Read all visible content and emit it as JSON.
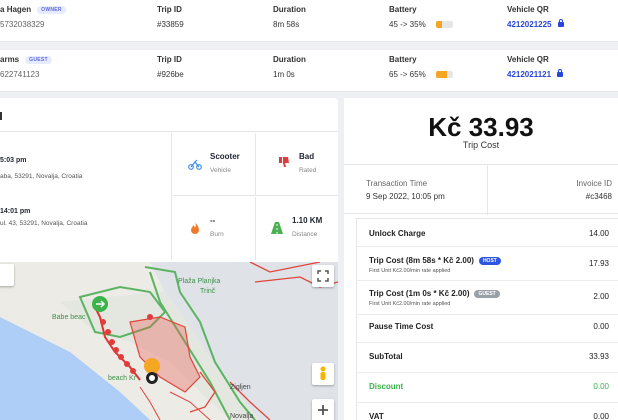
{
  "trips": [
    {
      "user_name": "Hagen",
      "user_name_prefix": "a",
      "role": "OWNER",
      "phone": "5732038329",
      "trip_id_label": "Trip ID",
      "trip_id": "#33859",
      "duration_label": "Duration",
      "duration": "8m 58s",
      "battery_label": "Battery",
      "battery": "45 -> 35%",
      "battery_level": 0.35,
      "vehicle_qr_label": "Vehicle QR",
      "vehicle_qr": "4212021225"
    },
    {
      "user_name": "arms",
      "role": "GUEST",
      "phone": "622741123",
      "trip_id_label": "Trip ID",
      "trip_id": "#926be",
      "duration_label": "Duration",
      "duration": "1m 0s",
      "battery_label": "Battery",
      "battery": "65 -> 65%",
      "battery_level": 0.65,
      "vehicle_qr_label": "Vehicle QR",
      "vehicle_qr": "4212021121"
    }
  ],
  "detail": {
    "route": {
      "start_time": "5:03 pm",
      "start_address": "aba, 53291, Novalja, Croatia",
      "end_time": "14:01 pm",
      "end_address": "ul. 43, 53291, Novalja, Croatia"
    },
    "stats": [
      {
        "value": "Scooter",
        "label": "Vehicle",
        "icon": "scooter-icon"
      },
      {
        "value": "Bad",
        "label": "Rated",
        "icon": "thumbs-down-icon"
      },
      {
        "value": "--",
        "label": "Burn",
        "icon": "flame-icon"
      },
      {
        "value": "1.10 KM",
        "label": "Distance",
        "icon": "road-icon"
      }
    ],
    "map": {
      "labels": [
        "Plaža Planjka",
        "Trinč",
        "Babe beach",
        "beach Kr",
        "Zigljen",
        "Novalja",
        "Zrće"
      ],
      "label_fallback": "Babe beac"
    }
  },
  "summary": {
    "amount": "Kč 33.93",
    "amount_label": "Trip Cost",
    "transaction_time_label": "Transaction Time",
    "transaction_time": "9 Sep 2022, 10:05 pm",
    "invoice_label": "Invoice ID",
    "invoice_id": "#c3468",
    "costs": [
      {
        "name": "Unlock Charge",
        "sub": "",
        "value": "14.00"
      },
      {
        "name": "Trip Cost (8m 58s * Kč 2.00)",
        "badge": "HOST",
        "sub": "First Unit Kč2.00/min rate applied",
        "value": "17.93"
      },
      {
        "name": "Trip Cost (1m 0s * Kč 2.00)",
        "badge": "GUEST",
        "sub": "First Unit Kč2.00/min rate applied",
        "value": "2.00"
      },
      {
        "name": "Pause Time Cost",
        "sub": "",
        "value": "0.00"
      },
      {
        "name": "SubTotal",
        "sub": "",
        "value": "33.93"
      },
      {
        "name": "Discount",
        "sub": "",
        "value": "0.00"
      },
      {
        "name": "VAT",
        "sub": "",
        "value": "0.00"
      }
    ]
  },
  "colors": {
    "accent": "#2745d6",
    "battery": "#f5a623",
    "host_badge": "#2f56e0",
    "guest_badge": "#9aa0a8",
    "discount": "#3bb34a"
  }
}
